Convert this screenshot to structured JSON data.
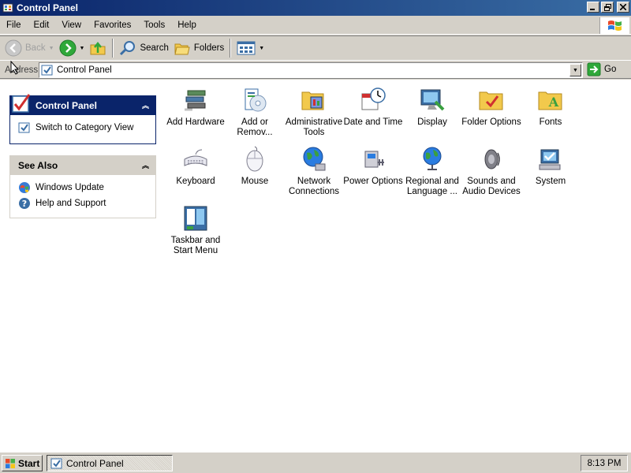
{
  "window": {
    "title": "Control Panel"
  },
  "menu": [
    "File",
    "Edit",
    "View",
    "Favorites",
    "Tools",
    "Help"
  ],
  "toolbar": {
    "back_label": "Back",
    "search_label": "Search",
    "folders_label": "Folders"
  },
  "address": {
    "label": "Address",
    "value": "Control Panel",
    "go_label": "Go"
  },
  "sidebar": {
    "control_panel": {
      "title": "Control Panel",
      "link": "Switch to Category View"
    },
    "see_also": {
      "title": "See Also",
      "links": [
        "Windows Update",
        "Help and Support"
      ]
    }
  },
  "items": [
    {
      "label": "Add Hardware",
      "icon": "add-hardware-icon"
    },
    {
      "label": "Add or Remov...",
      "icon": "add-remove-programs-icon"
    },
    {
      "label": "Administrative Tools",
      "icon": "administrative-tools-icon"
    },
    {
      "label": "Date and Time",
      "icon": "date-time-icon"
    },
    {
      "label": "Display",
      "icon": "display-icon"
    },
    {
      "label": "Folder Options",
      "icon": "folder-options-icon"
    },
    {
      "label": "Fonts",
      "icon": "fonts-icon"
    },
    {
      "label": "Keyboard",
      "icon": "keyboard-icon"
    },
    {
      "label": "Mouse",
      "icon": "mouse-icon"
    },
    {
      "label": "Network Connections",
      "icon": "network-connections-icon"
    },
    {
      "label": "Power Options",
      "icon": "power-options-icon"
    },
    {
      "label": "Regional and Language ...",
      "icon": "regional-language-icon"
    },
    {
      "label": "Sounds and Audio Devices",
      "icon": "sounds-audio-icon"
    },
    {
      "label": "System",
      "icon": "system-icon"
    },
    {
      "label": "Taskbar and Start Menu",
      "icon": "taskbar-start-menu-icon"
    }
  ],
  "taskbar": {
    "start_label": "Start",
    "task_label": "Control Panel",
    "clock": "8:13 PM"
  }
}
